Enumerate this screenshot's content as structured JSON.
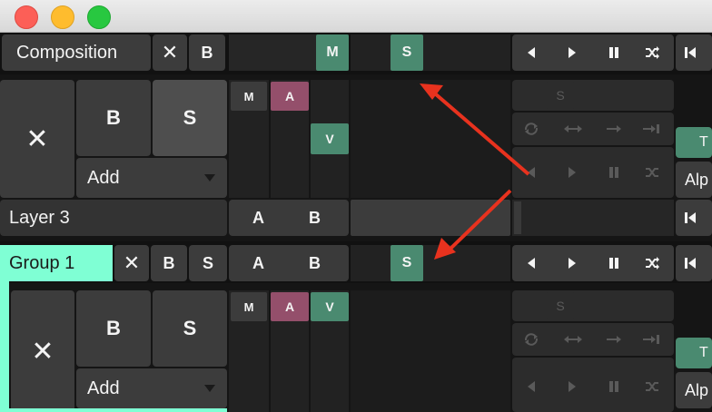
{
  "composition": {
    "title": "Composition",
    "close_label": "✕",
    "bypass_label": "B",
    "mute_label": "M",
    "solo_label": "S"
  },
  "layer": {
    "name": "Layer 3",
    "close_label": "✕",
    "bypass_label": "B",
    "solo_label": "S",
    "add_label": "Add",
    "mute_label": "M",
    "audio_label": "A",
    "video_label": "V",
    "a_label": "A",
    "b_label": "B",
    "solo_small_label": "S",
    "t_label": "T",
    "alpha_label": "Alp"
  },
  "group": {
    "name": "Group 1",
    "close_label": "✕",
    "bypass_label": "B",
    "solo_label": "S",
    "a_label": "A",
    "b_label": "B",
    "solo_green_label": "S"
  },
  "group_layer": {
    "close_label": "✕",
    "bypass_label": "B",
    "solo_label": "S",
    "add_label": "Add",
    "mute_label": "M",
    "audio_label": "A",
    "video_label": "V",
    "solo_small_label": "S",
    "t_label": "T",
    "alpha_label": "Alp"
  },
  "colors": {
    "green": "#4a8a70",
    "magenta": "#944f6b",
    "group_accent": "#7fffd4",
    "arrow": "#e8321e"
  }
}
